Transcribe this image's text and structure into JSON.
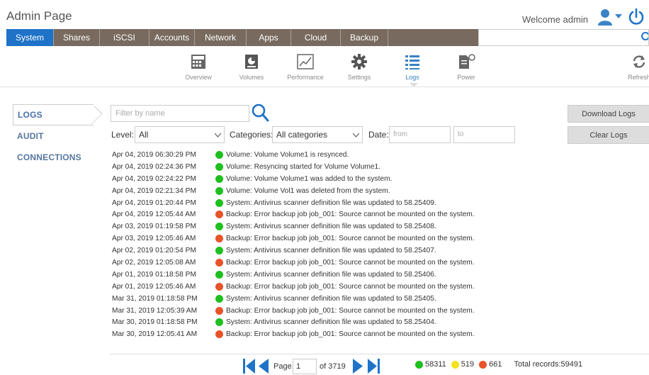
{
  "header": {
    "title": "Admin Page",
    "welcome": "Welcome admin"
  },
  "nav": {
    "tabs": [
      {
        "label": "System",
        "active": true
      },
      {
        "label": "Shares"
      },
      {
        "label": "iSCSI"
      },
      {
        "label": "Accounts"
      },
      {
        "label": "Network"
      },
      {
        "label": "Apps"
      },
      {
        "label": "Cloud"
      },
      {
        "label": "Backup"
      }
    ]
  },
  "toolbar": {
    "items": [
      {
        "label": "Overview",
        "icon": "overview-icon"
      },
      {
        "label": "Volumes",
        "icon": "volumes-icon"
      },
      {
        "label": "Performance",
        "icon": "performance-icon"
      },
      {
        "label": "Settings",
        "icon": "settings-icon"
      },
      {
        "label": "Logs",
        "icon": "logs-icon",
        "active": true
      },
      {
        "label": "Power",
        "icon": "power-settings-icon"
      },
      {
        "label": "Refresh",
        "icon": "refresh-icon"
      }
    ]
  },
  "sidebar": {
    "items": [
      {
        "label": "LOGS",
        "active": true
      },
      {
        "label": "AUDIT"
      },
      {
        "label": "CONNECTIONS"
      }
    ]
  },
  "filters": {
    "name_placeholder": "Filter by name",
    "level_label": "Level:",
    "level_value": "All",
    "categories_label": "Categories:",
    "categories_value": "All categories",
    "date_label": "Date:",
    "from_placeholder": "from",
    "to_placeholder": "to"
  },
  "actions": {
    "download": "Download Logs",
    "clear": "Clear Logs"
  },
  "logs": [
    {
      "time": "Apr 04, 2019 06:30:29 PM",
      "status": "green",
      "message": "Volume: Volume Volume1 is resynced."
    },
    {
      "time": "Apr 04, 2019 02:24:36 PM",
      "status": "green",
      "message": "Volume: Resyncing started for Volume Volume1."
    },
    {
      "time": "Apr 04, 2019 02:24:22 PM",
      "status": "green",
      "message": "Volume: Volume Volume1 was added to the system."
    },
    {
      "time": "Apr 04, 2019 02:21:34 PM",
      "status": "green",
      "message": "Volume: Volume Vol1 was deleted from the system."
    },
    {
      "time": "Apr 04, 2019 01:20:44 PM",
      "status": "green",
      "message": "System: Antivirus scanner definition file was updated to 58.25409."
    },
    {
      "time": "Apr 04, 2019 12:05:44 AM",
      "status": "red",
      "message": "Backup: Error backup job job_001: Source cannot be mounted on the system."
    },
    {
      "time": "Apr 03, 2019 01:19:58 PM",
      "status": "green",
      "message": "System: Antivirus scanner definition file was updated to 58.25408."
    },
    {
      "time": "Apr 03, 2019 12:05:46 AM",
      "status": "red",
      "message": "Backup: Error backup job job_001: Source cannot be mounted on the system."
    },
    {
      "time": "Apr 02, 2019 01:20:54 PM",
      "status": "green",
      "message": "System: Antivirus scanner definition file was updated to 58.25407."
    },
    {
      "time": "Apr 02, 2019 12:05:08 AM",
      "status": "red",
      "message": "Backup: Error backup job job_001: Source cannot be mounted on the system."
    },
    {
      "time": "Apr 01, 2019 01:18:58 PM",
      "status": "green",
      "message": "System: Antivirus scanner definition file was updated to 58.25406."
    },
    {
      "time": "Apr 01, 2019 12:05:46 AM",
      "status": "red",
      "message": "Backup: Error backup job job_001: Source cannot be mounted on the system."
    },
    {
      "time": "Mar 31, 2019 01:18:58 PM",
      "status": "green",
      "message": "System: Antivirus scanner definition file was updated to 58.25405."
    },
    {
      "time": "Mar 31, 2019 12:05:39 AM",
      "status": "red",
      "message": "Backup: Error backup job job_001: Source cannot be mounted on the system."
    },
    {
      "time": "Mar 30, 2019 01:18:58 PM",
      "status": "green",
      "message": "System: Antivirus scanner definition file was updated to 58.25404."
    },
    {
      "time": "Mar 30, 2019 12:05:41 AM",
      "status": "red",
      "message": "Backup: Error backup job job_001: Source cannot be mounted on the system."
    }
  ],
  "pager": {
    "page_label": "Page",
    "page": "1",
    "of_label": "of 3719"
  },
  "stats": {
    "green": "58311",
    "yellow": "519",
    "red": "661",
    "total": "Total records:59491"
  },
  "colors": {
    "nav_bg": "#786a5e",
    "active_tab": "#1e73c8",
    "accent": "#3b82c6",
    "ok": "#1fbf1f",
    "warn": "#f5e21c",
    "error": "#e8532a"
  }
}
